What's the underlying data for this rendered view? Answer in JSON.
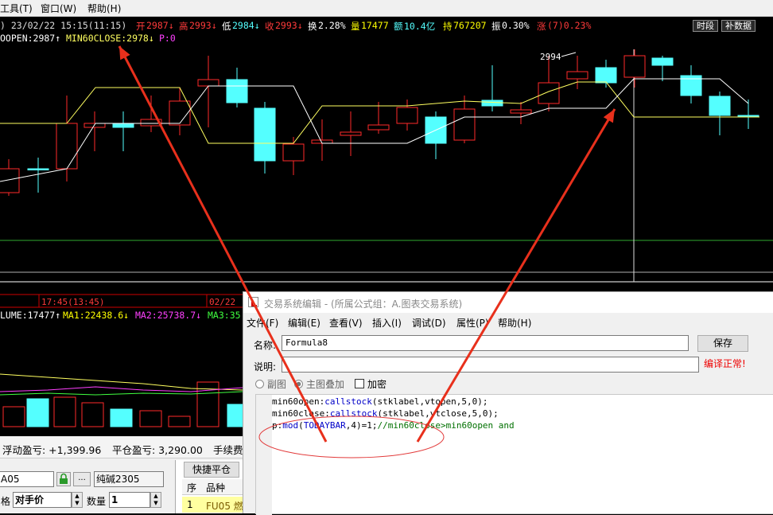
{
  "menubar": {
    "items": [
      "工具(T)",
      "窗口(W)",
      "帮助(H)"
    ]
  },
  "quote": {
    "datetime": ") 23/02/22 15:15(11:15)",
    "open_label": "开",
    "open": "2987↓",
    "high_label": "高",
    "high": "2993↓",
    "low_label": "低",
    "low": "2984↓",
    "close_label": "收",
    "close": "2993↓",
    "turnover_label": "换",
    "turnover": "2.28%",
    "volume_label": "量",
    "volume": "17477",
    "amount_label": "额",
    "amount": "10.4亿",
    "oi_label": "持",
    "oi": "767207",
    "amp_label": "振",
    "amp": "0.30%",
    "chg_label": "涨",
    "chg": "(7)0.23%",
    "btn_time": "时段",
    "btn_data": "补数据"
  },
  "indicator": {
    "open_text": "OOPEN:2987↑",
    "close_text": "MIN60CLOSE:2978↓",
    "p_text": "P:0"
  },
  "main_chart": {
    "peak_label": "2994"
  },
  "panel2": {
    "time1": "17:45(13:45)",
    "time2": "02/22",
    "volume_text": "LUME:17477↑",
    "ma1_text": "MA1:22438.6↓",
    "ma2_text": "MA2:25738.7↓",
    "ma3_text": "MA3:35"
  },
  "trade": {
    "float_pnl": "浮动盈亏: +1,399.96",
    "close_pnl": "平仓盈亏: 3,290.00",
    "fee": "手续费",
    "contract_code": "A05",
    "contract_name": "纯碱2305",
    "price_label": "格",
    "price_value": "对手价",
    "qty_label": "数量",
    "qty_value": "1",
    "quick_close": "快捷平仓",
    "list_headers": [
      "序",
      "品种"
    ],
    "list_row": [
      "1",
      "FU05 燃"
    ]
  },
  "dialog": {
    "title": "交易系统编辑 - (所属公式组：A.图表交易系统)",
    "menu": [
      "文件(F)",
      "编辑(E)",
      "查看(V)",
      "插入(I)",
      "调试(D)",
      "属性(P)",
      "帮助(H)"
    ],
    "name_label": "名称:",
    "name_value": "Formula8",
    "save": "保存",
    "desc_label": "说明:",
    "compiled": "编译正常!",
    "radio1": "副图",
    "radio2": "主图叠加",
    "check": "加密",
    "code": {
      "line1": {
        "a": "min60open:",
        "b": "callstock",
        "c": "(stklabel,vtopen,5,0);"
      },
      "line2": {
        "a": "min60close:",
        "b": "callstock",
        "c": "(stklabel,vtclose,5,0);"
      },
      "line3": {
        "a": "p:",
        "b": "mod",
        "c": "(",
        "d": "TODAYBAR",
        "e": ",4)=1;",
        "f": "//min60close>min60open and"
      }
    }
  },
  "colors": {
    "bull": "#ff2a2a",
    "bear": "#54ffff",
    "yellow_line": "#ffff60",
    "white_line": "#ffffff",
    "annotation": "#e8301c"
  }
}
